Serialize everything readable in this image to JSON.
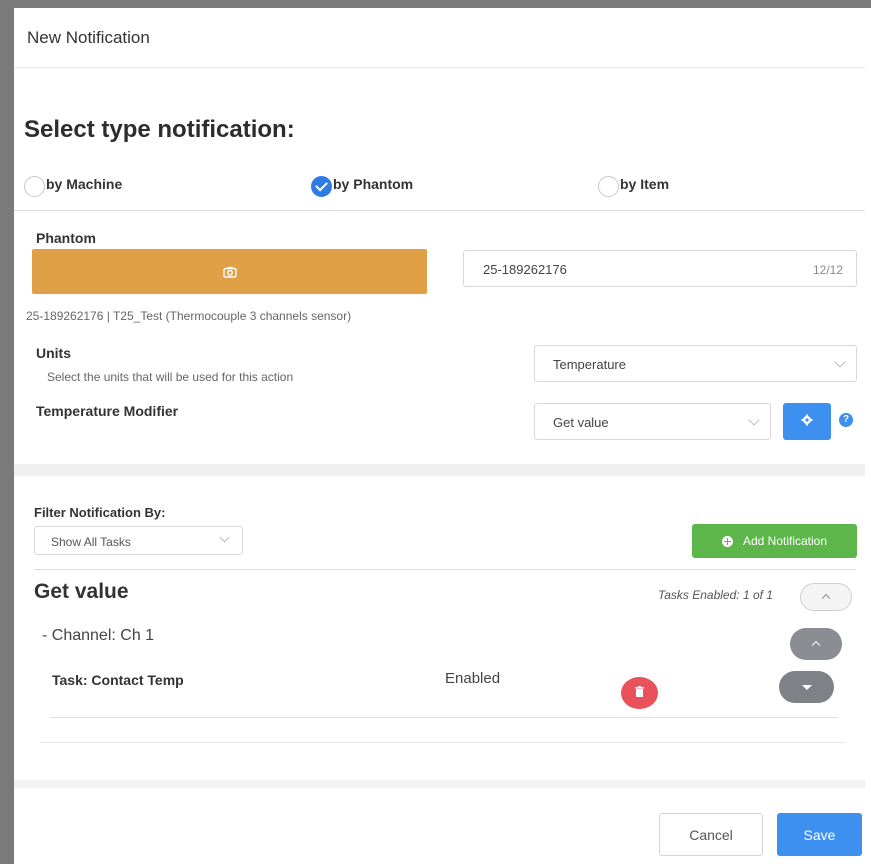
{
  "dialog": {
    "title": "New Notification"
  },
  "type_select": {
    "heading": "Select type notification:",
    "options": [
      {
        "label": "by Machine",
        "checked": false
      },
      {
        "label": "by Phantom",
        "checked": true
      },
      {
        "label": "by Item",
        "checked": false
      }
    ]
  },
  "phantom": {
    "label": "Phantom",
    "scan_icon": "camera-icon",
    "input_value": "25-189262176",
    "input_count": "12/12",
    "description": "25-189262176 | T25_Test (Thermocouple 3 channels sensor)"
  },
  "units": {
    "label": "Units",
    "help_text": "Select the units that will be used for this action",
    "selected": "Temperature"
  },
  "modifier": {
    "label": "Temperature Modifier",
    "selected": "Get value",
    "settings_icon": "gear-icon",
    "help_icon_text": "?"
  },
  "filter": {
    "label": "Filter Notification By:",
    "selected": "Show All Tasks",
    "add_button": "Add Notification"
  },
  "group": {
    "title": "Get value",
    "tasks_enabled": "Tasks Enabled: 1 of 1",
    "channel": "- Channel: Ch 1",
    "task_name": "Task: Contact Temp",
    "task_status": "Enabled",
    "delete_icon": "trash-icon"
  },
  "footer": {
    "cancel": "Cancel",
    "save": "Save"
  },
  "colors": {
    "accent_blue": "#3d8ff0",
    "scan_orange": "#e0a045",
    "add_green": "#5cb64a",
    "delete_red": "#e9525a"
  }
}
